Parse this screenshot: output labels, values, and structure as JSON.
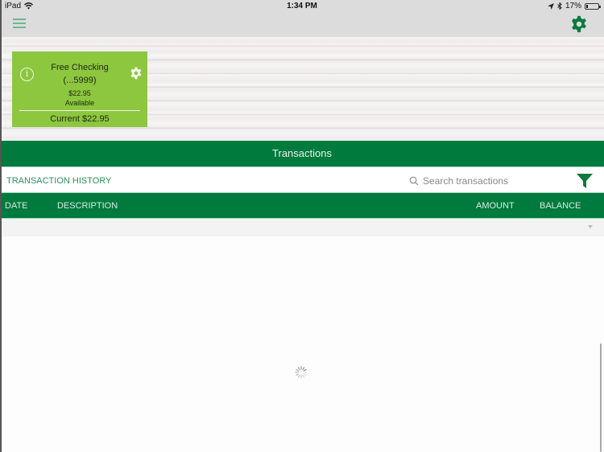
{
  "status_bar": {
    "device": "iPad",
    "time": "1:34 PM",
    "battery_percent_label": "17%",
    "battery_level": 0.17,
    "icons": [
      "wifi-icon",
      "location-icon",
      "bluetooth-icon",
      "battery-icon"
    ]
  },
  "nav": {
    "menu_icon": "hamburger-menu-icon",
    "settings_icon": "gear-icon"
  },
  "account_card": {
    "name": "Free Checking",
    "number": "(...5999)",
    "available_amount": "$22.95",
    "available_label": "Available",
    "current_label": "Current $22.95",
    "info_icon": "info-icon",
    "settings_icon": "gear-icon"
  },
  "transactions": {
    "title": "Transactions",
    "history_label": "TRANSACTION HISTORY",
    "search": {
      "placeholder": "Search transactions",
      "value": ""
    },
    "filter_icon": "filter-icon",
    "columns": [
      "DATE",
      "DESCRIPTION",
      "AMOUNT",
      "BALANCE"
    ],
    "rows": [],
    "loading": true
  },
  "colors": {
    "brand_green": "#007a3d",
    "card_green": "#8dc63f",
    "accent_text": "#2e8f60"
  }
}
